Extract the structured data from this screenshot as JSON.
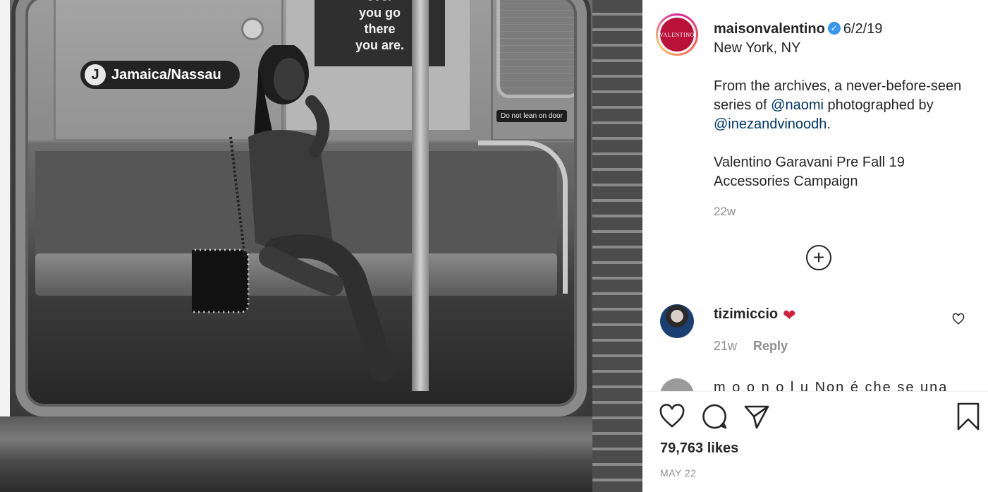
{
  "post": {
    "username": "maisonvalentino",
    "avatar_text": "VALENTINO",
    "date": "6/2/19",
    "location": "New York, NY",
    "caption_1": "From the archives, a never-before-seen series of",
    "mention_1": "@naomi",
    "caption_2": "photographed by",
    "mention_2": "@inezandvinoodh",
    "caption_3": ".",
    "caption_4": "Valentino Garavani Pre Fall 19 Accessories Campaign",
    "age": "22w"
  },
  "photo": {
    "subway_line": "J",
    "station_sign": "Jamaica/Nassau",
    "ad_text_1": "ever",
    "ad_text_2": "you go",
    "ad_text_3": "there",
    "ad_text_4": "you are.",
    "door_notice": "Do not lean on door"
  },
  "comments": [
    {
      "username": "tizimiccio",
      "emoji": "❤",
      "age": "21w",
      "reply_label": "Reply"
    },
    {
      "partial_text": "m o o n o l u   Non é che se una"
    }
  ],
  "footer": {
    "likes": "79,763 likes",
    "date": "MAY 22"
  },
  "icons": {
    "load_more": "plus-circle-icon",
    "like": "heart-outline-icon",
    "comment": "comment-bubble-icon",
    "share": "paper-plane-icon",
    "save": "bookmark-icon",
    "verified": "verified-badge-icon"
  },
  "colors": {
    "link": "#00376b",
    "muted": "#8e8e8e",
    "verified": "#3897f0",
    "brand": "#b9113a"
  }
}
